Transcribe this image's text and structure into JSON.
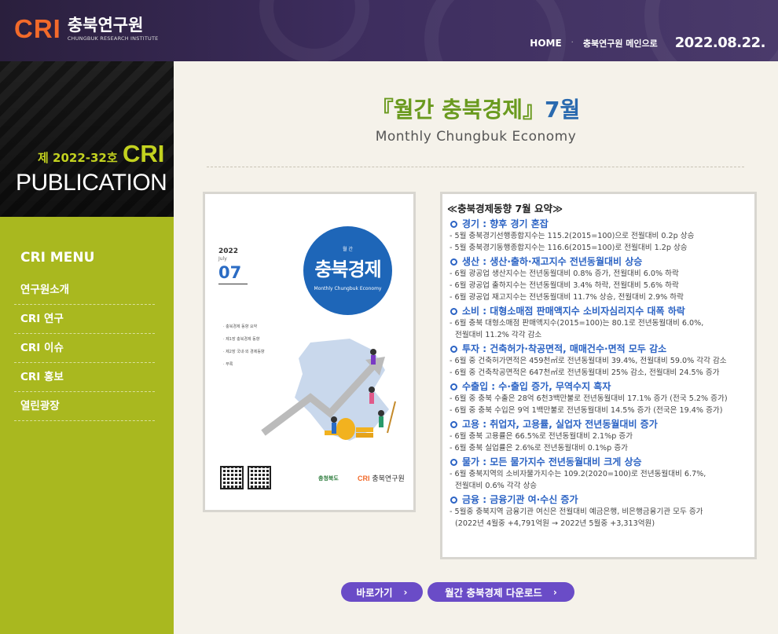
{
  "header": {
    "logo_mark": "CRI",
    "logo_name": "충북연구원",
    "logo_sub": "CHUNGBUK RESEARCH INSTITUTE",
    "nav_home": "HOME",
    "nav_separator": "·",
    "nav_main": "충북연구원 메인으로",
    "date": "2022.08.22."
  },
  "sidebar": {
    "issue_no": "제 2022-32호",
    "issue_brand": "CRI",
    "publication": "PUBLICATION",
    "menu_title": "CRI MENU",
    "items": [
      {
        "label": "연구원소개"
      },
      {
        "label": "CRI 연구"
      },
      {
        "label": "CRI 이슈"
      },
      {
        "label": "CRI 홍보"
      },
      {
        "label": "열린광장"
      }
    ]
  },
  "main": {
    "title_prefix": "『월간 충북경제』",
    "title_suffix": "7월",
    "subtitle": "Monthly Chungbuk Economy"
  },
  "cover": {
    "year": "2022",
    "month": "July",
    "number": "07",
    "circle_small": "월 간",
    "circle_title": "충북경제",
    "circle_en": "Monthly Chungbuk Economy",
    "toc": [
      "· 충북경제 동향 요약",
      "· 제1장 충북경제 동향",
      "· 제2장 국내·외 경제동향",
      "· 부록"
    ],
    "logo_province": "충청북도",
    "logo_cri": "CRI",
    "logo_cri_name": "충북연구원"
  },
  "summary": {
    "heading": "≪충북경제동향 7월 요약≫",
    "sections": [
      {
        "title": "경기 : 향후 경기 혼잡",
        "lines": [
          "- 5월 충북경기선행종합지수는 115.2(2015=100)으로 전월대비 0.2p 상승",
          "- 5월 충북경기동행종합지수는 116.6(2015=100)로 전월대비 1.2p 상승"
        ]
      },
      {
        "title": "생산 : 생산·출하·재고지수 전년동월대비 상승",
        "lines": [
          "- 6월 광공업 생산지수는 전년동월대비 0.8% 증가, 전월대비 6.0% 하락",
          "- 6월 광공업 출하지수는 전년동월대비 3.4% 하락, 전월대비 5.6% 하락",
          "- 6월 광공업 재고지수는 전년동월대비 11.7% 상승, 전월대비 2.9% 하락"
        ]
      },
      {
        "title": "소비 : 대형소매점 판매액지수 소비자심리지수 대폭 하락",
        "lines": [
          "- 6월 충북 대형소매점 판매액지수(2015=100)는 80.1로 전년동월대비 6.0%,",
          "전월대비 11.2% 각각 감소"
        ]
      },
      {
        "title": "투자 : 건축허가·착공면적, 매매건수·면적 모두 감소",
        "lines": [
          "- 6월 중 건축허가면적은 459천㎡로 전년동월대비 39.4%, 전월대비 59.0% 각각 감소",
          "- 6월 중 건축착공면적은 647천㎡로 전년동월대비 25% 감소, 전월대비 24.5% 증가"
        ]
      },
      {
        "title": "수출입 : 수·출입 증가, 무역수지 흑자",
        "lines": [
          "- 6월 중 충북 수출은 28억 6천3백만불로 전년동월대비 17.1% 증가 (전국 5.2% 증가)",
          "- 6월 중 충북 수입은 9억 1백만불로 전년동월대비 14.5% 증가 (전국은 19.4% 증가)"
        ]
      },
      {
        "title": "고용 : 취업자, 고용률, 실업자 전년동월대비 증가",
        "lines": [
          "- 6월 충북 고용률은 66.5%로 전년동월대비 2.1%p 증가",
          "- 6월 충북 실업률은 2.6%로 전년동월대비 0.1%p 증가"
        ]
      },
      {
        "title": "물가 : 모든 물가지수 전년동월대비 크게 상승",
        "lines": [
          "- 6월 충북지역의 소비자물가지수는 109.2(2020=100)로 전년동월대비 6.7%,",
          "전월대비 0.6% 각각 상승"
        ]
      },
      {
        "title": "금융 :  금융기관 여·수신 증가",
        "lines": [
          "- 5월중 충북지역 금융기관 여신은 전월대비 예금은행, 비은행금융기관 모두 증가",
          "(2022년 4월중 +4,791억원 → 2022년 5월중 +3,313억원)"
        ]
      }
    ]
  },
  "buttons": {
    "go": "바로가기",
    "download": "월간 충북경제  다운로드",
    "arrow": "›"
  }
}
